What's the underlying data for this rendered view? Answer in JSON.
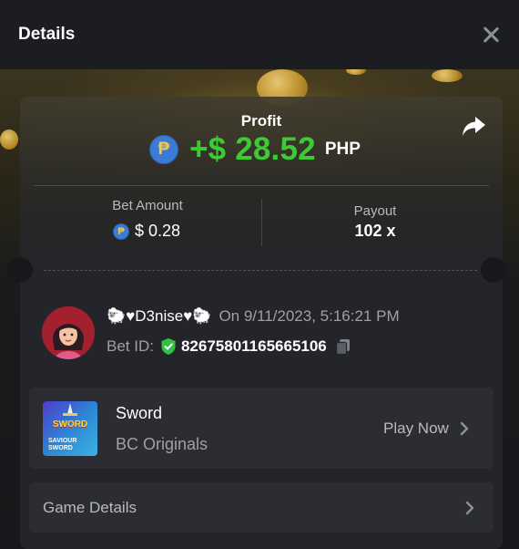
{
  "header": {
    "title": "Details"
  },
  "profit": {
    "label": "Profit",
    "currency_symbol": "₱",
    "amount": "+$ 28.52",
    "currency": "PHP"
  },
  "bet": {
    "amount_label": "Bet Amount",
    "amount_value": "$ 0.28",
    "payout_label": "Payout",
    "payout_value": "102 x"
  },
  "user": {
    "name": "🐑♥D3nise♥🐑",
    "date": "On 9/11/2023, 5:16:21 PM",
    "bet_id_label": "Bet ID:",
    "bet_id": "82675801165665106"
  },
  "game": {
    "name": "Sword",
    "provider": "BC Originals",
    "thumb_title": "SWORD",
    "thumb_subtitle": "SAVIOUR SWORD",
    "play_label": "Play Now"
  },
  "game_details": {
    "label": "Game Details"
  },
  "colors": {
    "accent_green": "#3ccb34",
    "background": "#17181b",
    "card": "#24252a",
    "muted_text": "#9ea0a6"
  },
  "icons": [
    "close-icon",
    "share-icon",
    "peso-coin-icon",
    "shield-check-icon",
    "copy-icon",
    "chevron-right-icon"
  ]
}
